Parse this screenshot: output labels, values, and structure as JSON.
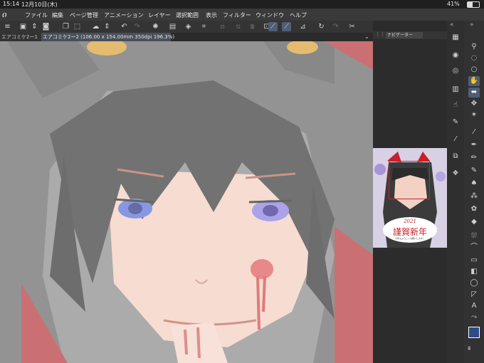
{
  "status": {
    "time": "15:14",
    "date": "12月10日(木)",
    "battery": "41%"
  },
  "menu": [
    "ファイル",
    "編集",
    "ページ管理",
    "アニメーション",
    "レイヤー",
    "選択範囲",
    "表示",
    "フィルター",
    "ウィンドウ",
    "ヘルプ"
  ],
  "tabs": [
    {
      "label": "エアコミケ2ー1",
      "active": false
    },
    {
      "label": "エアコミケ2ー2 (106.00 x 154.00mm 350dpi 196.3%)",
      "active": true
    }
  ],
  "navigator": {
    "title": "ナビゲーター"
  },
  "card": {
    "year": "2021",
    "greeting": "謹賀新年",
    "subtext": "今年もよろしくお願いします！"
  },
  "colors": {
    "accent": "#4f5e76",
    "main_color": "#2d4a8a",
    "sub_color": "#ffffff",
    "brand_red": "#c8202a"
  },
  "toolbar_icons": [
    "menu-icon",
    "new-icon",
    "sort-icon",
    "save-icon",
    "copy-icon",
    "transform-icon",
    "cloud-icon",
    "pan-icon",
    "undo-icon",
    "redo-icon",
    "loading-icon",
    "clear-icon",
    "fill-icon",
    "crop-icon",
    "select-all-icon",
    "deselect-icon",
    "invert-icon",
    "border-icon",
    "pen-stroke-icon",
    "pen-stroke-2-icon",
    "ruler-icon",
    "rotate-icon",
    "redo-2-icon",
    "scissors-icon"
  ],
  "panel_icons": [
    "navigator-icon",
    "layer-icon",
    "brush-size-icon",
    "property-icon",
    "hand-icon",
    "pen-icon",
    "eyedropper-icon",
    "material-icon",
    "layers-icon"
  ],
  "tool_icons": [
    "zoom-icon",
    "lasso-icon",
    "lasso-2-icon",
    "hand-icon",
    "move-icon",
    "move-layer-icon",
    "sparkle-icon",
    "eyedropper-icon",
    "pen-icon",
    "pencil-icon",
    "brush-icon",
    "brush-2-icon",
    "airbrush-icon",
    "decoration-icon",
    "eraser-icon",
    "fill-icon",
    "curve-icon",
    "frame-icon",
    "gradient-icon",
    "lasso-shape-icon",
    "polygon-icon",
    "text-icon",
    "balloon-icon",
    "correction-icon"
  ]
}
